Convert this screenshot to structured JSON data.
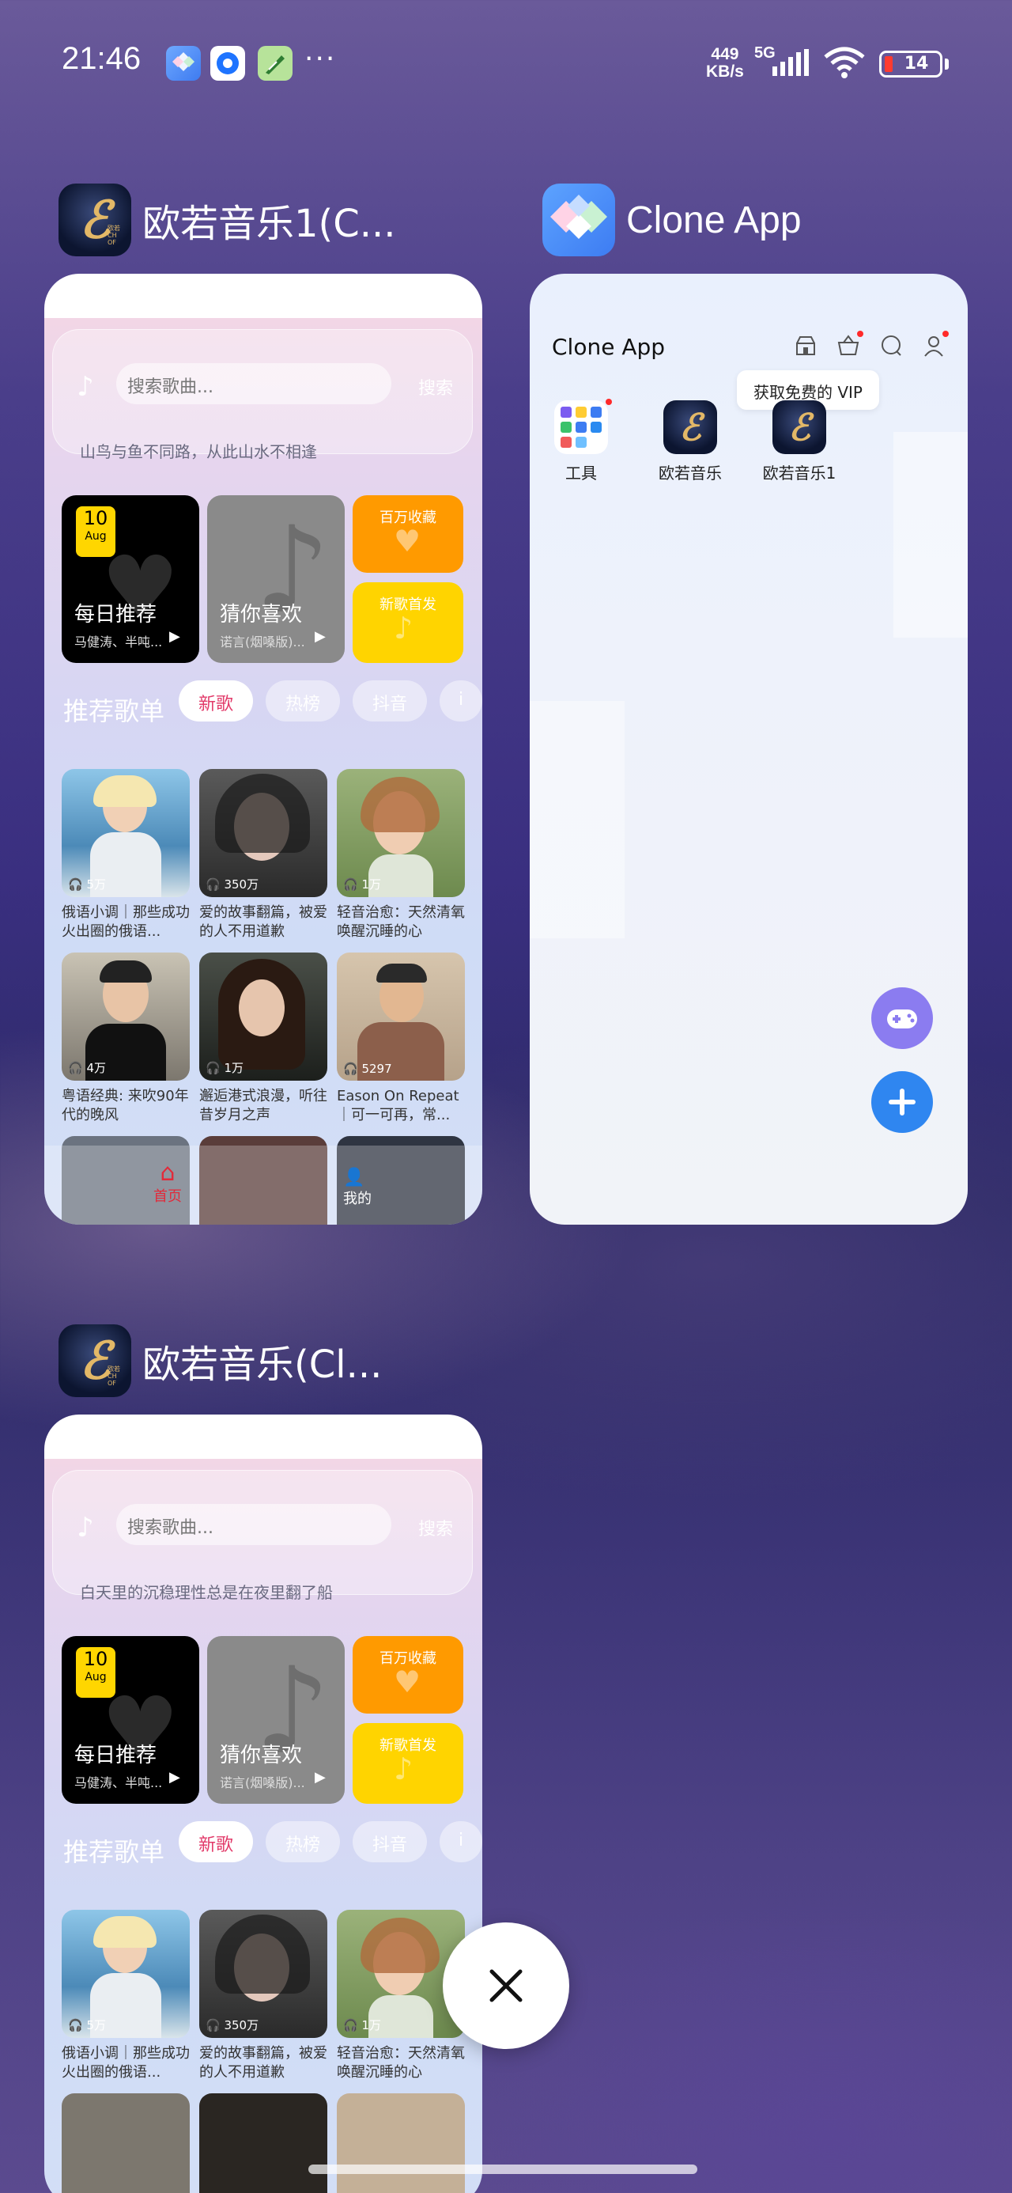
{
  "status_bar": {
    "time": "21:46",
    "more": "···",
    "speed_top": "449",
    "speed_bottom": "KB/s",
    "network": "5G",
    "battery": "14"
  },
  "cards": {
    "music1": {
      "title": "欧若音乐1(C...",
      "search_placeholder": "搜索歌曲...",
      "search_button": "搜索",
      "motto": "山鸟与鱼不同路，从此山水不相逢",
      "daily": {
        "day": "10",
        "month": "Aug",
        "title": "每日推荐",
        "sub": "马健涛、半吨..."
      },
      "guess": {
        "title": "猜你喜欢",
        "sub": "诺言(烟嗓版)..."
      },
      "fav": "百万收藏",
      "new_first": "新歌首发",
      "section": "推荐歌单",
      "chips": [
        "新歌",
        "热榜",
        "抖音",
        "i"
      ],
      "playlists": [
        {
          "count": "5万",
          "name": "俄语小调｜那些成功火出圈的俄语..."
        },
        {
          "count": "350万",
          "name": "爱的故事翻篇，被爱的人不用道歉"
        },
        {
          "count": "1万",
          "name": "轻音治愈：天然清氧唤醒沉睡的心"
        },
        {
          "count": "4万",
          "name": "粤语经典: 来吹90年代的晚风"
        },
        {
          "count": "1万",
          "name": "邂逅港式浪漫，听往昔岁月之声"
        },
        {
          "count": "5297",
          "name": "Eason On Repeat｜可一可再，常..."
        }
      ],
      "tab_home": "首页",
      "tab_me": "我的"
    },
    "clone": {
      "title": "Clone App",
      "header": "Clone App",
      "vip_tip": "获取免费的 VIP",
      "apps": [
        {
          "label": "工具"
        },
        {
          "label": "欧若音乐"
        },
        {
          "label": "欧若音乐1"
        }
      ]
    },
    "music2": {
      "title": "欧若音乐(Cl...",
      "search_placeholder": "搜索歌曲...",
      "search_button": "搜索",
      "motto": "白天里的沉稳理性总是在夜里翻了船",
      "daily": {
        "day": "10",
        "month": "Aug",
        "title": "每日推荐",
        "sub": "马健涛、半吨..."
      },
      "guess": {
        "title": "猜你喜欢",
        "sub": "诺言(烟嗓版)..."
      },
      "fav": "百万收藏",
      "new_first": "新歌首发",
      "section": "推荐歌单",
      "chips": [
        "新歌",
        "热榜",
        "抖音",
        "i"
      ],
      "playlists": [
        {
          "count": "5万",
          "name": "俄语小调｜那些成功火出圈的俄语..."
        },
        {
          "count": "350万",
          "name": "爱的故事翻篇，被爱的人不用道歉"
        },
        {
          "count": "1万",
          "name": "轻音治愈：天然清氧唤醒沉睡的心"
        }
      ]
    }
  },
  "logo_text": "欧若\nCH\nOF",
  "icons": [
    "clone-app-icon",
    "browser-icon",
    "feather-icon",
    "signal-icon",
    "wifi-icon",
    "battery-icon",
    "music-note-icon",
    "heart-icon",
    "play-icon",
    "headphones-icon",
    "home-icon",
    "person-icon",
    "shop-icon",
    "basket-icon",
    "chat-icon",
    "user-icon",
    "gamepad-icon",
    "plus-icon",
    "close-icon"
  ],
  "colors": {
    "accent_red": "#e23b6a",
    "fab_blue": "#2f86f0",
    "fab_purple": "#8b7cf0"
  }
}
